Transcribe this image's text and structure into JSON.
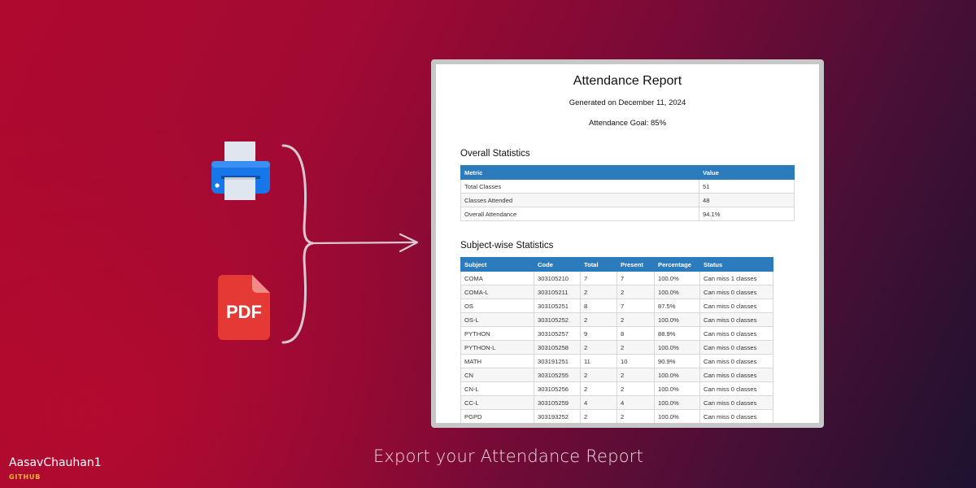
{
  "icons": {
    "printer": "printer-icon",
    "pdf": "pdf-file-icon",
    "brace": "curly-brace-arrow"
  },
  "pdf_label": "PDF",
  "colors": {
    "printer_blue": "#1877e8",
    "pdf_red": "#e53935",
    "table_header": "#2b7bbd",
    "credit_accent": "#f2b632"
  },
  "report": {
    "title": "Attendance Report",
    "generated": "Generated on December 11, 2024",
    "goal": "Attendance Goal: 85%",
    "overall": {
      "heading": "Overall Statistics",
      "columns": [
        "Metric",
        "Value"
      ],
      "rows": [
        [
          "Total Classes",
          "51"
        ],
        [
          "Classes Attended",
          "48"
        ],
        [
          "Overall Attendance",
          "94.1%"
        ]
      ]
    },
    "subjects": {
      "heading": "Subject-wise Statistics",
      "columns": [
        "Subject",
        "Code",
        "Total",
        "Present",
        "Percentage",
        "Status"
      ],
      "rows": [
        [
          "COMA",
          "303105210",
          "7",
          "7",
          "100.0%",
          "Can miss 1 classes"
        ],
        [
          "COMA-L",
          "303105211",
          "2",
          "2",
          "100.0%",
          "Can miss 0 classes"
        ],
        [
          "OS",
          "303105251",
          "8",
          "7",
          "87.5%",
          "Can miss 0 classes"
        ],
        [
          "OS-L",
          "303105252",
          "2",
          "2",
          "100.0%",
          "Can miss 0 classes"
        ],
        [
          "PYTHON",
          "303105257",
          "9",
          "8",
          "88.9%",
          "Can miss 0 classes"
        ],
        [
          "PYTHON-L",
          "303105258",
          "2",
          "2",
          "100.0%",
          "Can miss 0 classes"
        ],
        [
          "MATH",
          "303191251",
          "11",
          "10",
          "90.9%",
          "Can miss 0 classes"
        ],
        [
          "CN",
          "303105255",
          "2",
          "2",
          "100.0%",
          "Can miss 0 classes"
        ],
        [
          "CN-L",
          "303105256",
          "2",
          "2",
          "100.0%",
          "Can miss 0 classes"
        ],
        [
          "CC-L",
          "303105259",
          "4",
          "4",
          "100.0%",
          "Can miss 0 classes"
        ],
        [
          "PGPD",
          "303193252",
          "2",
          "2",
          "100.0%",
          "Can miss 0 classes"
        ]
      ]
    }
  },
  "caption": "Export your Attendance Report",
  "credit": {
    "name": "AasavChauhan1",
    "platform": "GITHUB"
  }
}
